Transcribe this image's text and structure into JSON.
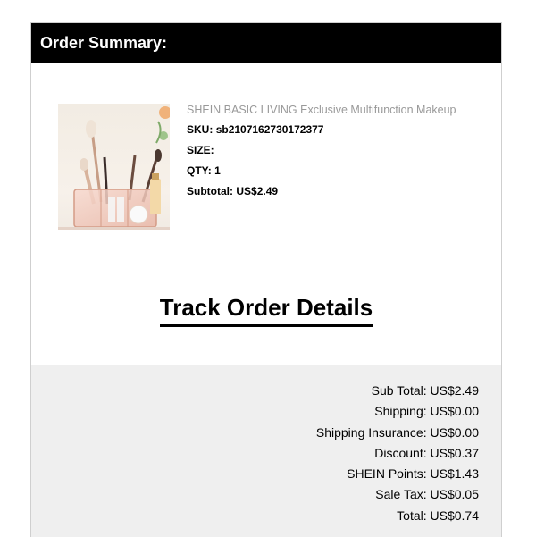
{
  "header": {
    "title": "Order Summary:"
  },
  "product": {
    "name": "SHEIN BASIC LIVING Exclusive Multifunction Makeup",
    "image_alt": "makeup organizer with brushes",
    "sku_label": "SKU:",
    "sku": "sb2107162730172377",
    "size_label": "SIZE:",
    "size": "",
    "qty_label": "QTY:",
    "qty": "1",
    "subtotal_label": "Subtotal:",
    "subtotal": "US$2.49"
  },
  "track": {
    "label": "Track Order Details"
  },
  "totals": [
    {
      "label": "Sub Total:",
      "value": "US$2.49"
    },
    {
      "label": "Shipping:",
      "value": "US$0.00"
    },
    {
      "label": "Shipping Insurance:",
      "value": "US$0.00"
    },
    {
      "label": "Discount:",
      "value": "US$0.37"
    },
    {
      "label": "SHEIN Points:",
      "value": "US$1.43"
    },
    {
      "label": "Sale Tax:",
      "value": "US$0.05"
    },
    {
      "label": "Total:",
      "value": "US$0.74"
    }
  ],
  "colors": {
    "header_bg": "#000000",
    "summary_bg": "#efefef",
    "product_name": "#999999"
  }
}
